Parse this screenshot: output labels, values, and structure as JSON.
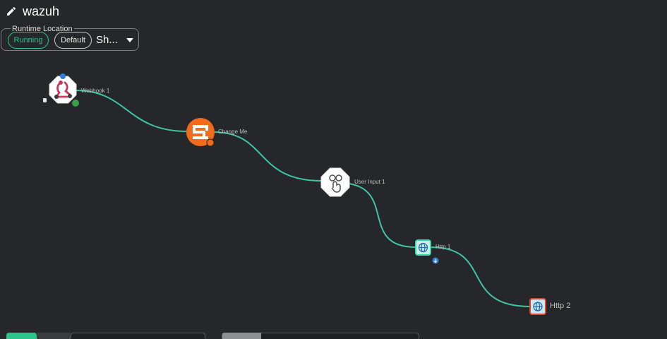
{
  "workflow": {
    "name": "wazuh",
    "edit_icon": "pencil-icon"
  },
  "runtime": {
    "legend": "Runtime Location",
    "status": "Running",
    "location": "Default",
    "selected": "Sh..."
  },
  "nodes": {
    "webhook": {
      "label": "Webhook 1",
      "icon": "webhook-icon"
    },
    "change_me": {
      "label": "Change Me",
      "icon": "shuffle-tools-icon"
    },
    "user_input": {
      "label": "User Input 1",
      "icon": "user-input-icon"
    },
    "http1": {
      "label": "Http 1",
      "icon": "globe-icon"
    },
    "http2": {
      "label": "Http 2",
      "icon": "globe-icon"
    }
  },
  "colors": {
    "background": "#26272a",
    "edge": "#3ec6a0",
    "running": "#2bc48a",
    "orange": "#f26a1b",
    "http_border": "#3ad8b0",
    "selected_border": "#d6462e",
    "badge_blue": "#2f7fd6",
    "badge_green": "#3aa04a"
  }
}
